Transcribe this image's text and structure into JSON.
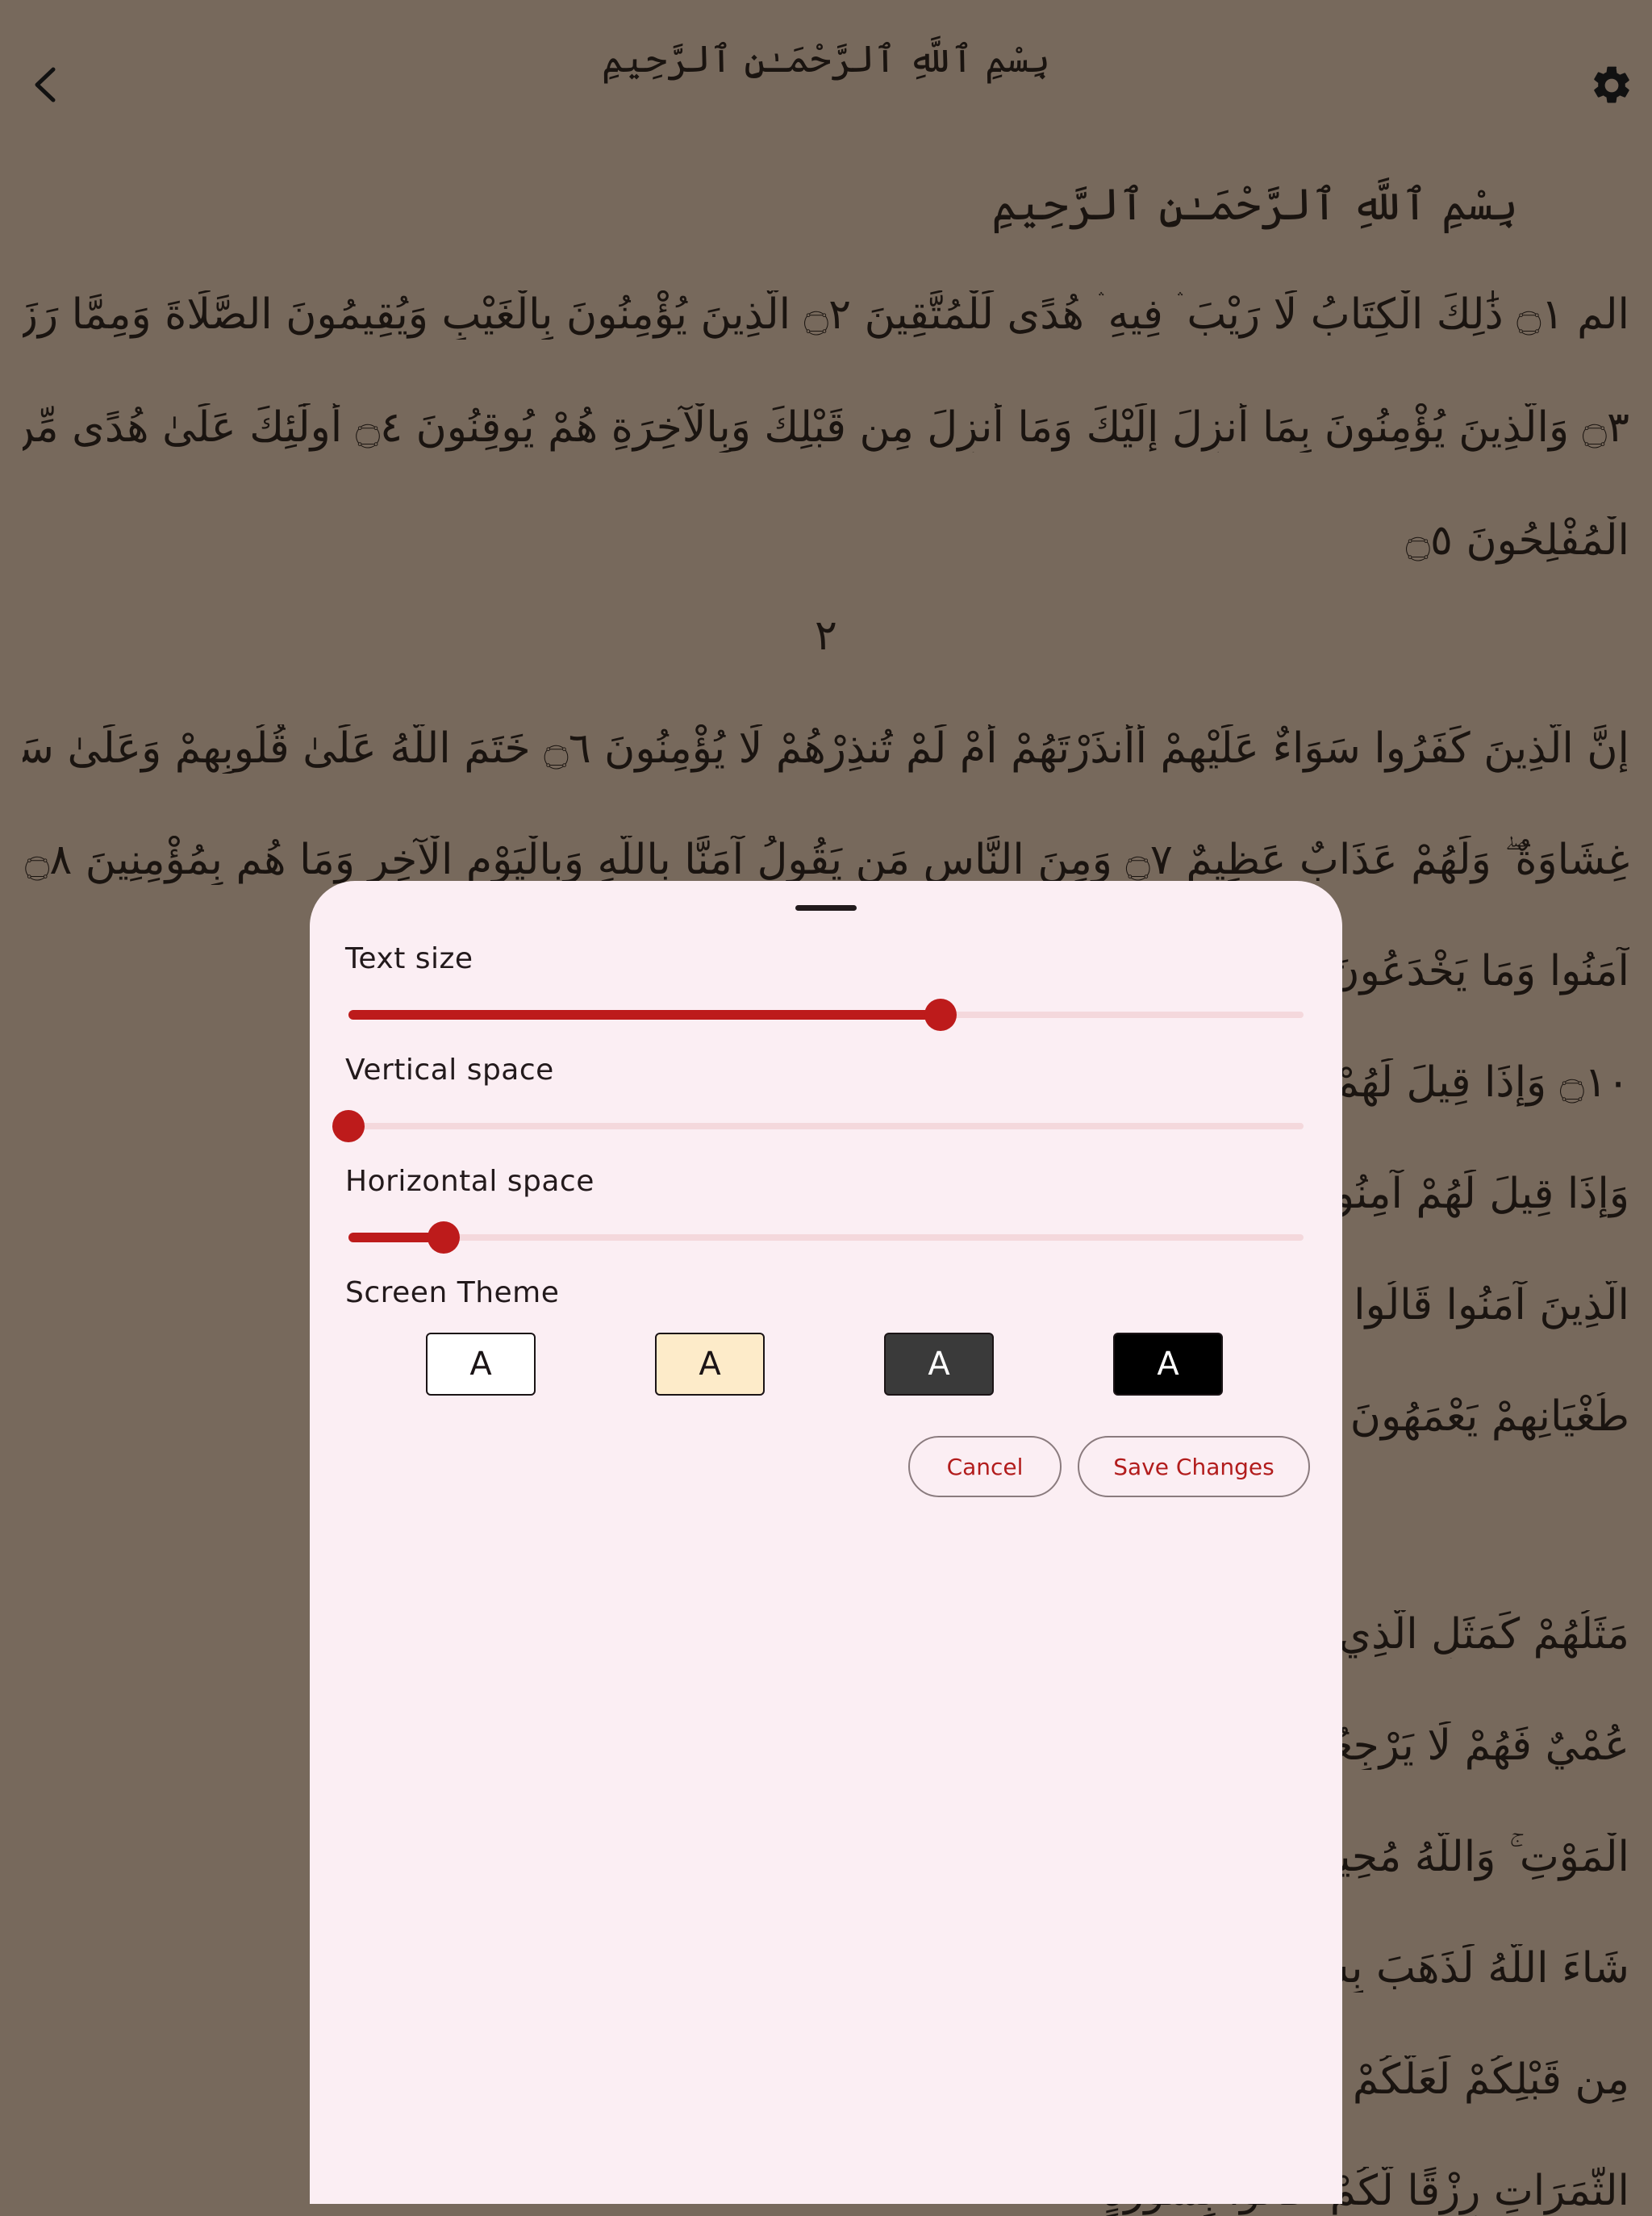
{
  "header": {
    "title": "بِسْمِ ٱللَّهِ ٱلرَّحْمَـٰنِ ٱلرَّحِيمِ"
  },
  "icons": {
    "back": "chevron-left-icon",
    "settings": "gear-icon"
  },
  "reader": {
    "basmala": "بِسْمِ ٱللَّهِ ٱلرَّحْمَـٰنِ ٱلرَّحِيمِ",
    "lines_top": [
      "الم ۝١ ذَٰلِكَ الْكِتَابُ لَا رَيْبَ ۛ فِيهِ ۛ هُدًى لِّلْمُتَّقِينَ ۝٢ الَّذِينَ يُؤْمِنُونَ بِالْغَيْبِ وَيُقِيمُونَ الصَّلَاةَ وَمِمَّا رَزَقْنَاهُمْ يُنفِقُونَ",
      "۝٣ وَالَّذِينَ يُؤْمِنُونَ بِمَا أُنزِلَ إِلَيْكَ وَمَا أُنزِلَ مِن قَبْلِكَ وَبِالْآخِرَةِ هُمْ يُوقِنُونَ ۝٤ أُولَٰئِكَ عَلَىٰ هُدًى مِّن رَّبِّهِمْ ۖ وَأُولَٰئِكَ هُمُ",
      "الْمُفْلِحُونَ ۝٥"
    ],
    "page_number": "٢",
    "lines_mid": [
      "إِنَّ الَّذِينَ كَفَرُوا سَوَاءٌ عَلَيْهِمْ أَأَنذَرْتَهُمْ أَمْ لَمْ تُنذِرْهُمْ لَا يُؤْمِنُونَ ۝٦ خَتَمَ اللَّهُ عَلَىٰ قُلُوبِهِمْ وَعَلَىٰ سَمْعِهِمْ ۖ وَعَلَىٰ أَبْصَارِهِمْ",
      "غِشَاوَةٌ ۖ وَلَهُمْ عَذَابٌ عَظِيمٌ ۝٧ وَمِنَ النَّاسِ مَن يَقُولُ آمَنَّا بِاللَّهِ وَبِالْيَوْمِ الْآخِرِ وَمَا هُم بِمُؤْمِنِينَ ۝٨ يُخَادِعُونَ اللَّهَ وَالَّذِينَ",
      "آمَنُوا وَمَا يَخْدَعُونَ إِلَّا                                                  يمٌ بِمَا كَانُوا يَكْذِبُونَ",
      "۝١٠ وَإِذَا قِيلَ لَهُمْ لَا تُ                                                  ن لَّا يَشْعُرُونَ ۝١٢",
      "وَإِذَا قِيلَ لَهُمْ آمِنُوا كَمَ                                                  عْلَمُونَ ۝١٣ وَإِذَا لَقُوا",
      "الَّذِينَ آمَنُوا قَالُوا آمَنَّا وَ                                                  ئُ بِهِمْ وَيَمُدُّهُمْ فِي",
      "طُغْيَانِهِمْ يَعْمَهُونَ ۝١٥                                                  ۝١٦"
    ],
    "lines_bottom": [
      "مَثَلُهُمْ كَمَثَلِ الَّذِي اسْ                                                  ونَ ۝١٧ صُمٌّ بُكْمٌ",
      "عُمْيٌ فَهُمْ لَا يَرْجِعُونَ                                                  هِم مِّنَ الصَّوَاعِقِ حَذَرَ",
      "الْمَوْتِ ۚ وَاللَّهُ مُحِيطٌ بِالْ                                                  مَ عَلَيْهِمْ قَامُوا ۚ وَلَوْ",
      "شَاءَ اللَّهُ لَذَهَبَ بِسَمْعِهِ                                                  ى خَلَقَكُمْ وَالَّذِينَ",
      "مِن قَبْلِكُمْ لَعَلَّكُمْ                                                  فَأَخْرَجَ بِهِ مِنَ",
      "الثَّمَرَاتِ رِزْقًا لَّكُمْ ۖ                                                  فَأْتُوا بِسُورَةٍ"
    ]
  },
  "settings_sheet": {
    "text_size": {
      "label": "Text size",
      "value": 0.62
    },
    "vertical_space": {
      "label": "Vertical space",
      "value": 0.0
    },
    "horizontal_space": {
      "label": "Horizontal space",
      "value": 0.1
    },
    "screen_theme": {
      "label": "Screen Theme",
      "options": [
        {
          "glyph": "A",
          "bg": "#ffffff",
          "fg": "#1b1416"
        },
        {
          "glyph": "A",
          "bg": "#fdebc9",
          "fg": "#1b1416"
        },
        {
          "glyph": "A",
          "bg": "#3a3a3a",
          "fg": "#ffffff"
        },
        {
          "glyph": "A",
          "bg": "#000000",
          "fg": "#ffffff"
        }
      ]
    },
    "cancel_label": "Cancel",
    "save_label": "Save Changes"
  },
  "colors": {
    "backdrop": "#77695c",
    "sheet_bg": "#fbeef3",
    "accent": "#bd1b1b",
    "track": "#f4d8dc"
  }
}
